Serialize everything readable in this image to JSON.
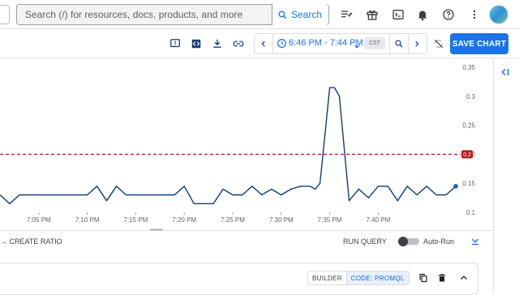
{
  "search": {
    "placeholder": "Search (/) for resources, docs, products, and more",
    "button_label": "Search"
  },
  "top_icons": [
    "release-notes-icon",
    "gift-icon",
    "cloud-shell-icon",
    "notifications-icon",
    "help-icon",
    "more-vert-icon",
    "avatar"
  ],
  "toolbar": {
    "icons": [
      "feedback-icon",
      "code-icon",
      "download-icon",
      "link-icon"
    ],
    "time_range": "6:46 PM - 7:44 PM",
    "timezone": "CST",
    "save_label": "SAVE CHART"
  },
  "footer": {
    "create_ratio": "→ CREATE RATIO",
    "run_query": "RUN QUERY",
    "auto_run": "Auto-Run"
  },
  "query_panel": {
    "builder_label": "BUILDER",
    "code_label": "CODE: PROMQL"
  },
  "colors": {
    "accent": "#1a73e8",
    "series": "#0d3f74",
    "threshold": "#b71c1c"
  },
  "chart_data": {
    "type": "line",
    "x_tick_labels": [
      "7:05 PM",
      "7:10 PM",
      "7:15 PM",
      "7:20 PM",
      "7:25 PM",
      "7:30 PM",
      "7:35 PM",
      "7:40 PM"
    ],
    "y_tick_labels": [
      "0.1",
      "0.15",
      "0.2",
      "0.25",
      "0.3",
      "0.35"
    ],
    "ylim": [
      0.1,
      0.35
    ],
    "xlim_minutes_past_7pm": [
      1,
      48.5
    ],
    "threshold": {
      "value": 0.2,
      "label": "0.2"
    },
    "series": [
      {
        "x": [
          1,
          2,
          3,
          4,
          5,
          6,
          7,
          8,
          9,
          10,
          11,
          12,
          13,
          14,
          15,
          16,
          17,
          18,
          19,
          20,
          21,
          22,
          23,
          24,
          25,
          26,
          27,
          28,
          29,
          30,
          31,
          32,
          33,
          33.5,
          34,
          35,
          35.5,
          36,
          37,
          38,
          39,
          40,
          41,
          42,
          43,
          44,
          45,
          46,
          47,
          48
        ],
        "y": [
          0.13,
          0.115,
          0.13,
          0.13,
          0.13,
          0.13,
          0.13,
          0.13,
          0.13,
          0.13,
          0.145,
          0.12,
          0.145,
          0.13,
          0.13,
          0.13,
          0.13,
          0.13,
          0.13,
          0.145,
          0.115,
          0.115,
          0.115,
          0.14,
          0.13,
          0.13,
          0.145,
          0.13,
          0.14,
          0.13,
          0.14,
          0.145,
          0.145,
          0.14,
          0.15,
          0.315,
          0.315,
          0.3,
          0.12,
          0.14,
          0.125,
          0.145,
          0.145,
          0.12,
          0.145,
          0.13,
          0.145,
          0.13,
          0.13,
          0.145
        ]
      }
    ],
    "grid": false,
    "y_axis_side": "right"
  }
}
